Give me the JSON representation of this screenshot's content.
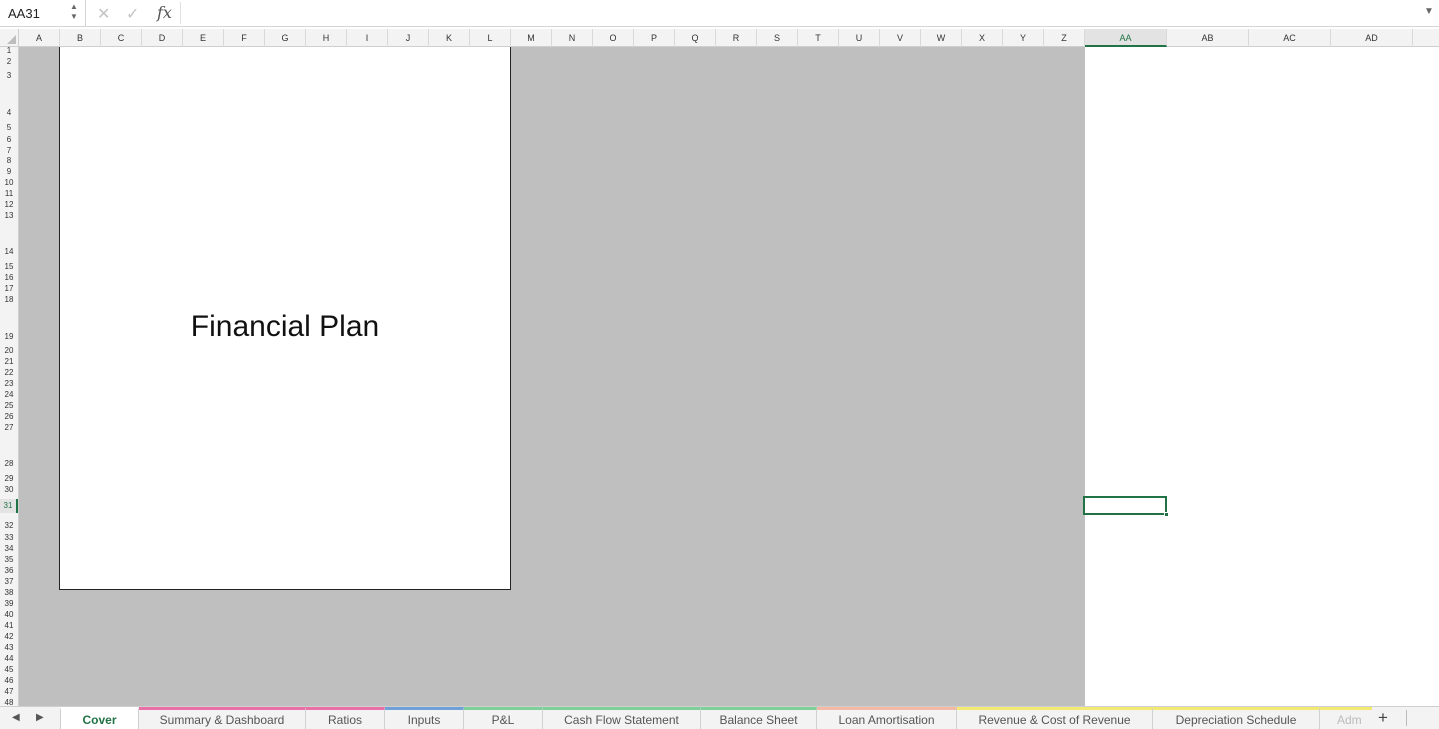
{
  "formula_bar": {
    "name_box": "AA31",
    "formula": "",
    "cancel_icon": "x-icon",
    "enter_icon": "check-icon",
    "fx_label": "fx"
  },
  "grid": {
    "columns": [
      "A",
      "B",
      "C",
      "D",
      "E",
      "F",
      "G",
      "H",
      "I",
      "J",
      "K",
      "L",
      "M",
      "N",
      "O",
      "P",
      "Q",
      "R",
      "S",
      "T",
      "U",
      "V",
      "W",
      "X",
      "Y",
      "Z",
      "AA",
      "AB",
      "AC",
      "AD"
    ],
    "active_column": "AA",
    "rows": [
      "1",
      "2",
      "3",
      "4",
      "5",
      "6",
      "7",
      "8",
      "9",
      "10",
      "11",
      "12",
      "13",
      "14",
      "15",
      "16",
      "17",
      "18",
      "19",
      "20",
      "21",
      "22",
      "23",
      "24",
      "25",
      "26",
      "27",
      "28",
      "29",
      "30",
      "31",
      "32",
      "33",
      "34",
      "35",
      "36",
      "37",
      "38",
      "39",
      "40",
      "41",
      "42",
      "43",
      "44",
      "45",
      "46",
      "47",
      "48"
    ],
    "active_row": "31"
  },
  "cover": {
    "title": "Financial Plan"
  },
  "colors": {
    "accent": "#217346",
    "gray_area": "#bfbfbf"
  },
  "sheets": {
    "active": "Cover",
    "tabs": [
      {
        "label": "Cover",
        "color": ""
      },
      {
        "label": "Summary & Dashboard",
        "color": "#e96fa7"
      },
      {
        "label": "Ratios",
        "color": "#e96fa7"
      },
      {
        "label": "Inputs",
        "color": "#6fa0d8"
      },
      {
        "label": "P&L",
        "color": "#7fcf9a"
      },
      {
        "label": "Cash Flow Statement",
        "color": "#7fcf9a"
      },
      {
        "label": "Balance Sheet",
        "color": "#7fcf9a"
      },
      {
        "label": "Loan Amortisation",
        "color": "#f4b8a6"
      },
      {
        "label": "Revenue & Cost of Revenue",
        "color": "#f3ea73"
      },
      {
        "label": "Depreciation Schedule",
        "color": "#f3ea73"
      },
      {
        "label": "Adm",
        "color": "#f3ea73"
      }
    ]
  }
}
